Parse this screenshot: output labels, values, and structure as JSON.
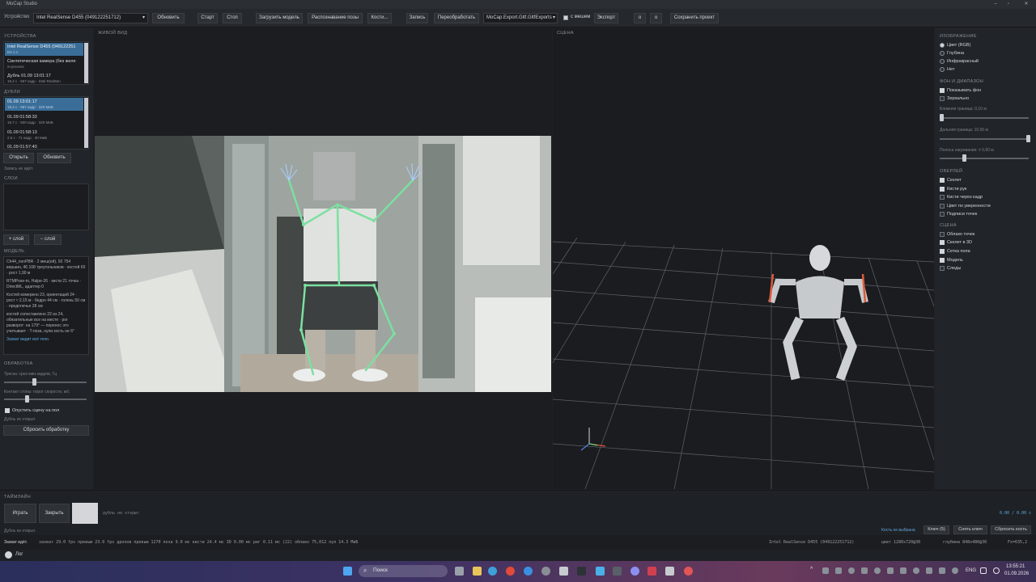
{
  "window": {
    "title": "MoCap Studio"
  },
  "toolbar": {
    "device_label": "Устройство",
    "device_value": "Intel RealSense D455 (049122251712)",
    "refresh": "Обновить",
    "start": "Старт",
    "stop": "Стоп",
    "load_model": "Загрузить модель",
    "pose_recognition": "Распознавание позы",
    "bones": "Кости...",
    "record": "Запись",
    "reprocess": "Переобработать",
    "export_format": "MoCap.Export.Gltf.GltfExports",
    "with_mesh": "с мешем",
    "export": "Экспорт",
    "btn_o1": "о",
    "btn_o2": "о",
    "save_project": "Сохранить проект"
  },
  "left": {
    "devices_title": "УСТРОЙСТВА",
    "devices": [
      {
        "name": "Intel RealSense D455 (049122251",
        "sub": "D4 1.1"
      },
      {
        "name": "Синтетическая камера (без желе",
        "sub": "in-process"
      },
      {
        "name": "Дубль 01.09 13:01:17",
        "sub": "19,2 с · 567 кадр · Intel RealSen"
      }
    ],
    "takes_title": "ДУБЛИ",
    "takes": [
      {
        "name": "01.09 13:01:17",
        "sub": "19,2 с · 567 кадр · 320 МиБ"
      },
      {
        "name": "01.09 01:58:33",
        "sub": "16,7 с · 500 кадр · 320 МиБ"
      },
      {
        "name": "01.09 01:58:13",
        "sub": "2,5 с · 71 кадр · 30 МиБ"
      },
      {
        "name": "01.09 01:57:40",
        "sub": ""
      }
    ],
    "open": "Открыть",
    "refresh": "Обновить",
    "no_record": "Запись не идёт.",
    "layers_title": "СЛОИ",
    "add_layer": "+ слой",
    "remove_layer": "− слой",
    "model_title": "МОДЕЛЬ",
    "model_info": [
      "Ch44_nonPBR · 2 меш(ей), 92 754 вершин, 46 108 треугольников · костей 65 · рост 1,90 м",
      "RTMPose-m, Halpe-26 · кисти 21 точка · DirectML, адаптер 0",
      "Костей измерено 23, ориентаций 24 · рост ≈ 2,15 м · бедро 44 см · голень 50 см · предплечье 28 см",
      "костей сопоставлено 22 из 24, обязательные все на месте · рог разворот: на 179° — перенос это учитывает · T-поза, нули кость не 6°"
    ],
    "model_link": "Захват видит всё тело.",
    "processing_title": "ОБРАБОТКА",
    "slider1_label": "Тряска: срез мин.кадров, Гц",
    "slider2_label": "Контакт стопы: порог скорости, м/с",
    "snap_floor": "Опустить сцену на пол",
    "no_take": "Дубль не открыт.",
    "reset_processing": "Сбросить обработку"
  },
  "live": {
    "title": "ЖИВОЙ ВИД"
  },
  "scene": {
    "title": "СЦЕНА"
  },
  "right": {
    "image_title": "ИЗОБРАЖЕНИЕ",
    "image_opts": [
      "Цвет (RGB)",
      "Глубина",
      "Инфракрасный",
      "Нет"
    ],
    "bg_title": "ФОН И ДИАПАЗОН",
    "show_bg": "Показывать фон",
    "mirror": "Зеркально",
    "near_label": "Ближняя граница: 0,10 м",
    "far_label": "Дальняя граница: 10,00 м",
    "band_label": "Полоса нагревания: ± 0,60 м",
    "overlay_title": "ОВЕРЛЕЙ",
    "overlay_opts": [
      "Скелет",
      "Кисти рук",
      "Кисти через кадр",
      "Цвет по уверенности",
      "Подписи точек"
    ],
    "scene_title": "СЦЕНА",
    "scene_opts": [
      "Облако точек",
      "Скелет в 3D",
      "Сетка пола",
      "Модель",
      "Следы"
    ]
  },
  "timeline": {
    "title": "ТАЙМЛАЙН",
    "play": "Играть",
    "close": "Закрыть",
    "status": "дубль не открыт",
    "no_take": "Дубль не открыт.",
    "time": "0.00 / 0.00 с",
    "bone_not_selected": "Кость не выбрана",
    "keys": "Ключ (5)",
    "remove_key": "Снять ключ",
    "reset_bone": "Сбросить кость"
  },
  "status": {
    "capture": "Захват идёт.",
    "metrics": "захват 29.0 fps  превью 23.0 fps  дропов превью 1270  поза 9.0 мс  кисти 24.4 мс  3D 0.00 мс  риг 0.11 мс (22)  облако 75,012  пул 14.3 МиБ",
    "device": "Intel RealSense D455 (049122251712)",
    "color": "цвет 1280x720@30",
    "depth": "глубина 848x480@30",
    "fx": "Fx=635,2"
  },
  "log": {
    "label": "Лог"
  },
  "taskbar": {
    "search": "Поиск",
    "lang": "ENG",
    "time": "13:55:21",
    "date": "01.09.2026"
  }
}
